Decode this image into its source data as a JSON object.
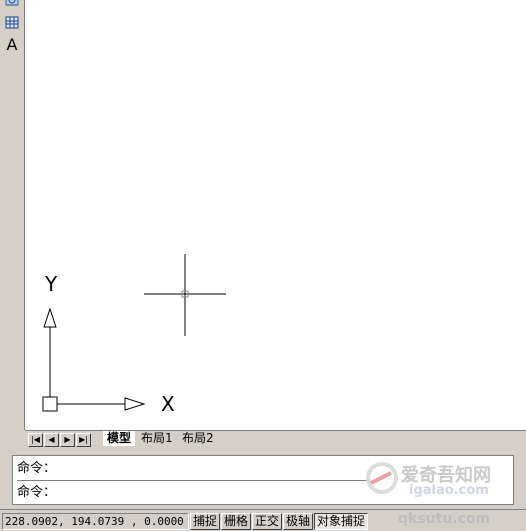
{
  "toolbar": {
    "tools": [
      {
        "icon": "globe-icon"
      },
      {
        "icon": "table-icon"
      },
      {
        "icon": "text-icon",
        "glyph": "A"
      }
    ]
  },
  "canvas": {
    "ucs": {
      "y_label": "Y",
      "x_label": "X"
    },
    "crosshair": "crosshair-cursor"
  },
  "tabs": {
    "nav": [
      "|◀",
      "◀",
      "▶",
      "▶|"
    ],
    "items": [
      {
        "label": "模型",
        "active": true
      },
      {
        "label": "布局1",
        "active": false
      },
      {
        "label": "布局2",
        "active": false
      }
    ]
  },
  "command": {
    "line1": "命令：",
    "line2": "命令："
  },
  "status": {
    "coords": "228.0902,  194.0739 ,  0.0000",
    "buttons": [
      {
        "label": "捕捉",
        "pressed": false
      },
      {
        "label": "栅格",
        "pressed": false
      },
      {
        "label": "正交",
        "pressed": false
      },
      {
        "label": "极轴",
        "pressed": false
      },
      {
        "label": "对象捕捉",
        "pressed": true
      }
    ]
  },
  "watermark": {
    "site1": "爱奇吾知网",
    "site2": "igalao.com",
    "site3": "qksutu.com"
  },
  "colors": {
    "canvas_bg": "#ffffff",
    "chrome": "#d4d0c8",
    "watermark": "#c9c9c9"
  }
}
